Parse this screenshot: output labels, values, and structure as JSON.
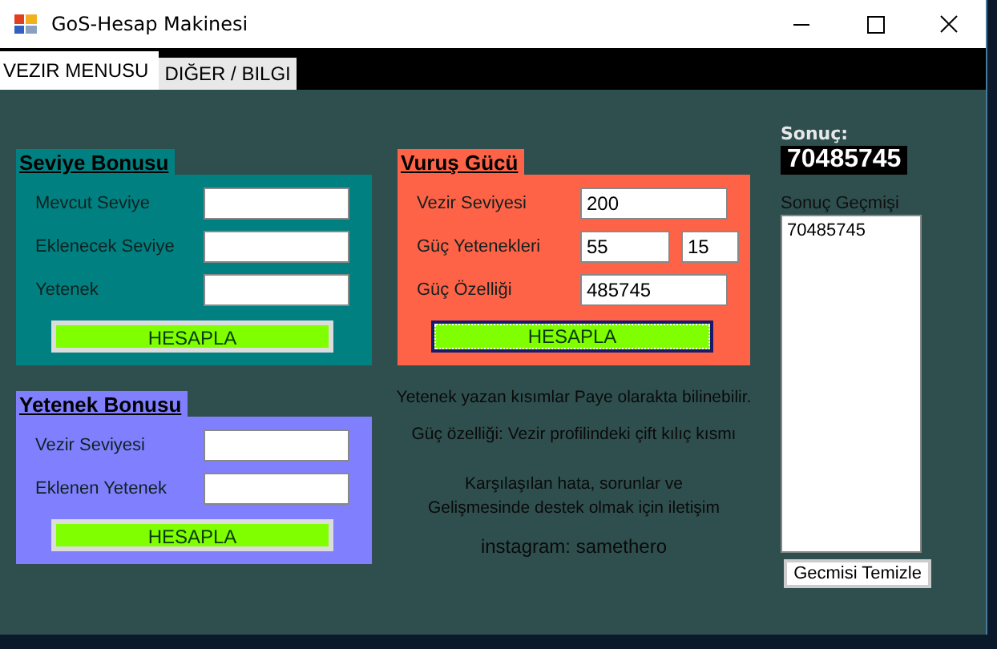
{
  "window": {
    "title": "GoS-Hesap Makinesi"
  },
  "tabs": [
    {
      "label": "VEZIR MENUSU",
      "selected": true
    },
    {
      "label": "DIĞER / BILGI",
      "selected": false
    }
  ],
  "left_panels": [
    {
      "title": "Seviye Bonusu",
      "color": "#008080",
      "fields": [
        {
          "label": "Mevcut Seviye"
        },
        {
          "label": "Eklenecek Seviye"
        },
        {
          "label": "Yetenek"
        }
      ],
      "button": {
        "label": "HESAPLA",
        "focused": false
      }
    },
    {
      "title": "Yetenek Bonusu",
      "color": "#8080ff",
      "fields": [
        {
          "label": "Vezir Seviyesi"
        },
        {
          "label": "Eklenen Yetenek"
        }
      ],
      "button": {
        "label": "HESAPLA",
        "focused": false
      }
    }
  ],
  "middle_panels": [
    {
      "title": "Vuruş Gücü",
      "color": "#ff6347",
      "fields": [
        {
          "label": "Vezir Seviyesi",
          "values": [
            "200"
          ]
        },
        {
          "label": "Güç Yetenekleri",
          "values": [
            "55",
            "15"
          ]
        },
        {
          "label": "Güç Özelliği",
          "values": [
            "485745"
          ]
        }
      ],
      "button": {
        "label": "HESAPLA",
        "focused": true
      }
    }
  ],
  "info": [
    "Yetenek yazan kısımlar Paye olarakta bilinebilir.",
    "Güç özelliği: Vezir profilindeki  çift kılıç kısmı",
    "Karşılaşılan hata, sorunlar ve",
    "Gelişmesinde destek olmak için iletişim",
    "instagram:  samethero"
  ],
  "result": {
    "label": "Sonuç:",
    "value": "70485745"
  },
  "history": {
    "label": "Sonuç Geçmişi",
    "items": [
      "70485745"
    ]
  },
  "clear_button": "Gecmisi Temizle"
}
